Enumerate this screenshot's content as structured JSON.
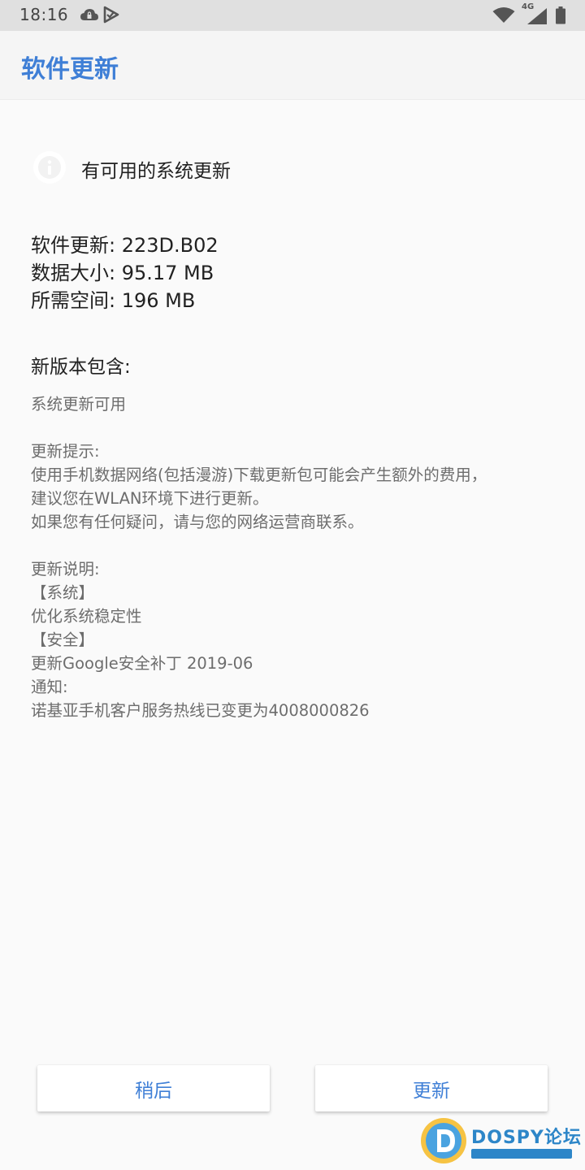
{
  "status_bar": {
    "time": "18:16",
    "network": "4G",
    "icons": [
      "cloud-lock-icon",
      "notification-check-icon",
      "wifi-icon",
      "cellular-signal-icon",
      "battery-icon"
    ]
  },
  "app_bar": {
    "title": "软件更新"
  },
  "availability": {
    "icon": "info-icon",
    "text": "有可用的系统更新"
  },
  "update_meta": {
    "version": "软件更新: 223D.B02",
    "data_size": "数据大小: 95.17 MB",
    "required_space": "所需空间: 196 MB"
  },
  "whats_new": {
    "title": "新版本包含:",
    "summary": "系统更新可用",
    "tips_title": "更新提示:",
    "tips_lines": [
      "使用手机数据网络(包括漫游)下载更新包可能会产生额外的费用，",
      "建议您在WLAN环境下进行更新。",
      "如果您有任何疑问，请与您的网络运营商联系。"
    ],
    "notes_title": "更新说明:",
    "notes_lines": [
      "【系统】",
      "优化系统稳定性",
      "【安全】",
      "更新Google安全补丁 2019-06",
      "通知:",
      "诺基亚手机客户服务热线已变更为4008000826"
    ]
  },
  "buttons": {
    "later": "稍后",
    "update": "更新"
  },
  "watermark": {
    "text": "DOSPY论坛"
  },
  "colors": {
    "accent": "#3f7fd6",
    "status_bar": "#e0e0e0",
    "background": "#fafafa",
    "secondary_text": "#6d6d6d"
  }
}
